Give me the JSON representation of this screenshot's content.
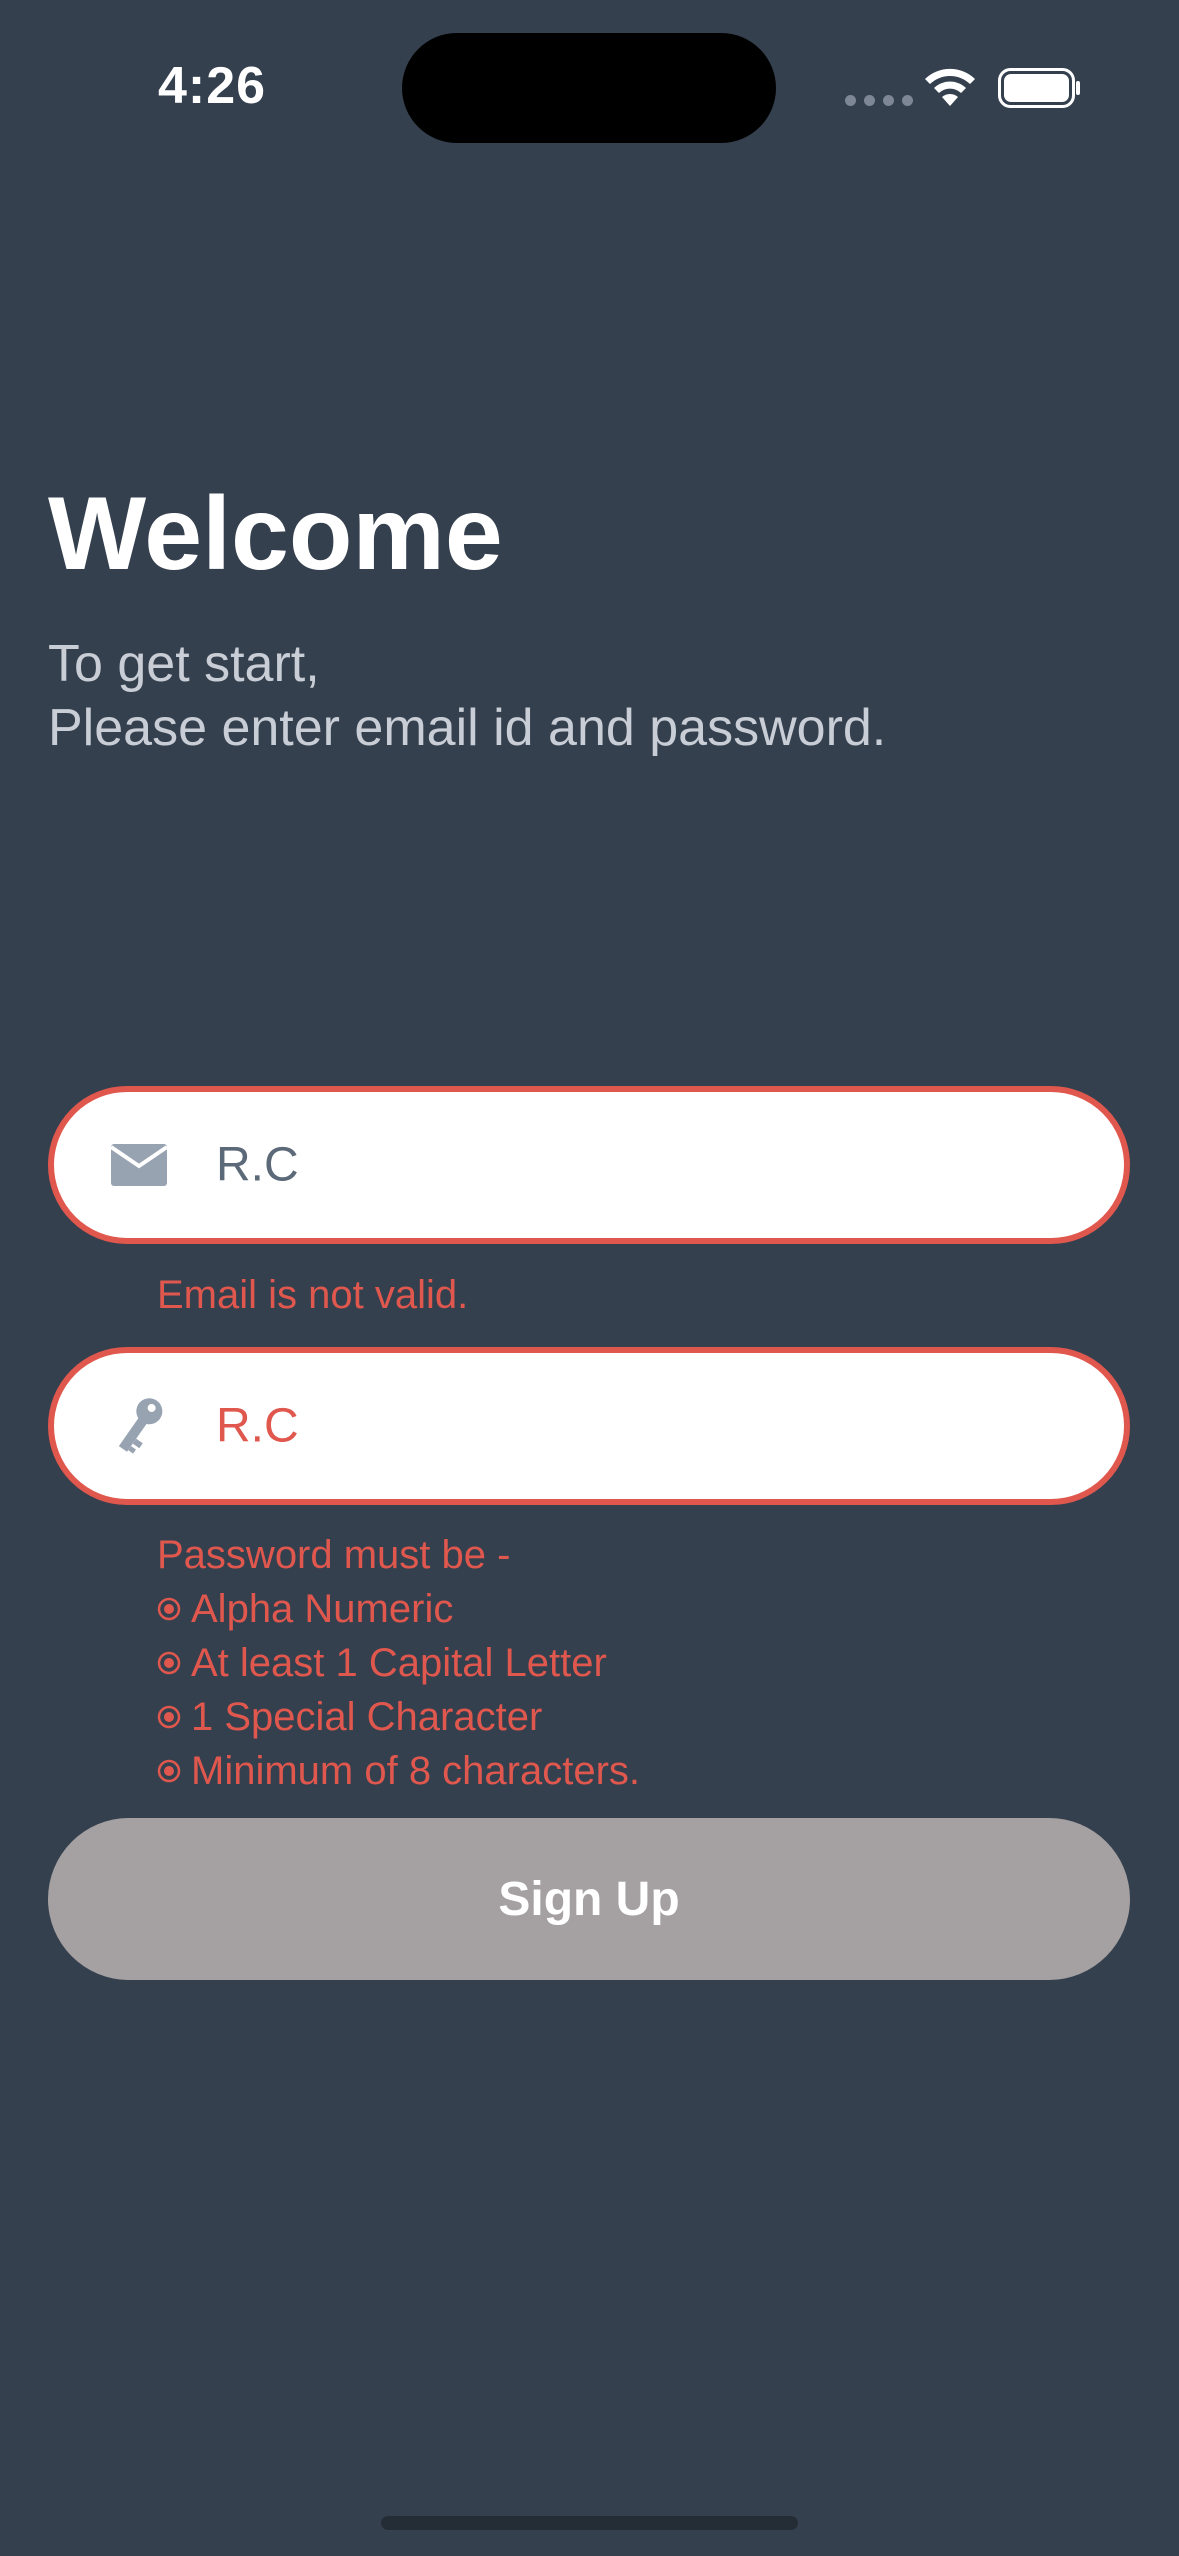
{
  "status_bar": {
    "time": "4:26"
  },
  "header": {
    "title": "Welcome",
    "subtitle_line1": "To get start,",
    "subtitle_line2": "Please enter email id and password."
  },
  "email_field": {
    "icon": "envelope-icon",
    "value": "R.C",
    "error": "Email is not valid."
  },
  "password_field": {
    "icon": "key-icon",
    "value": "R.C",
    "error_heading": "Password must be -",
    "rules": [
      "Alpha Numeric",
      "At least 1 Capital Letter",
      "1 Special Character",
      "Minimum of 8 characters."
    ]
  },
  "signup_button": {
    "label": "Sign Up"
  },
  "colors": {
    "background": "#35404f",
    "error": "#e0574d",
    "button_disabled": "#a5a1a2",
    "field_background": "#ffffff"
  }
}
